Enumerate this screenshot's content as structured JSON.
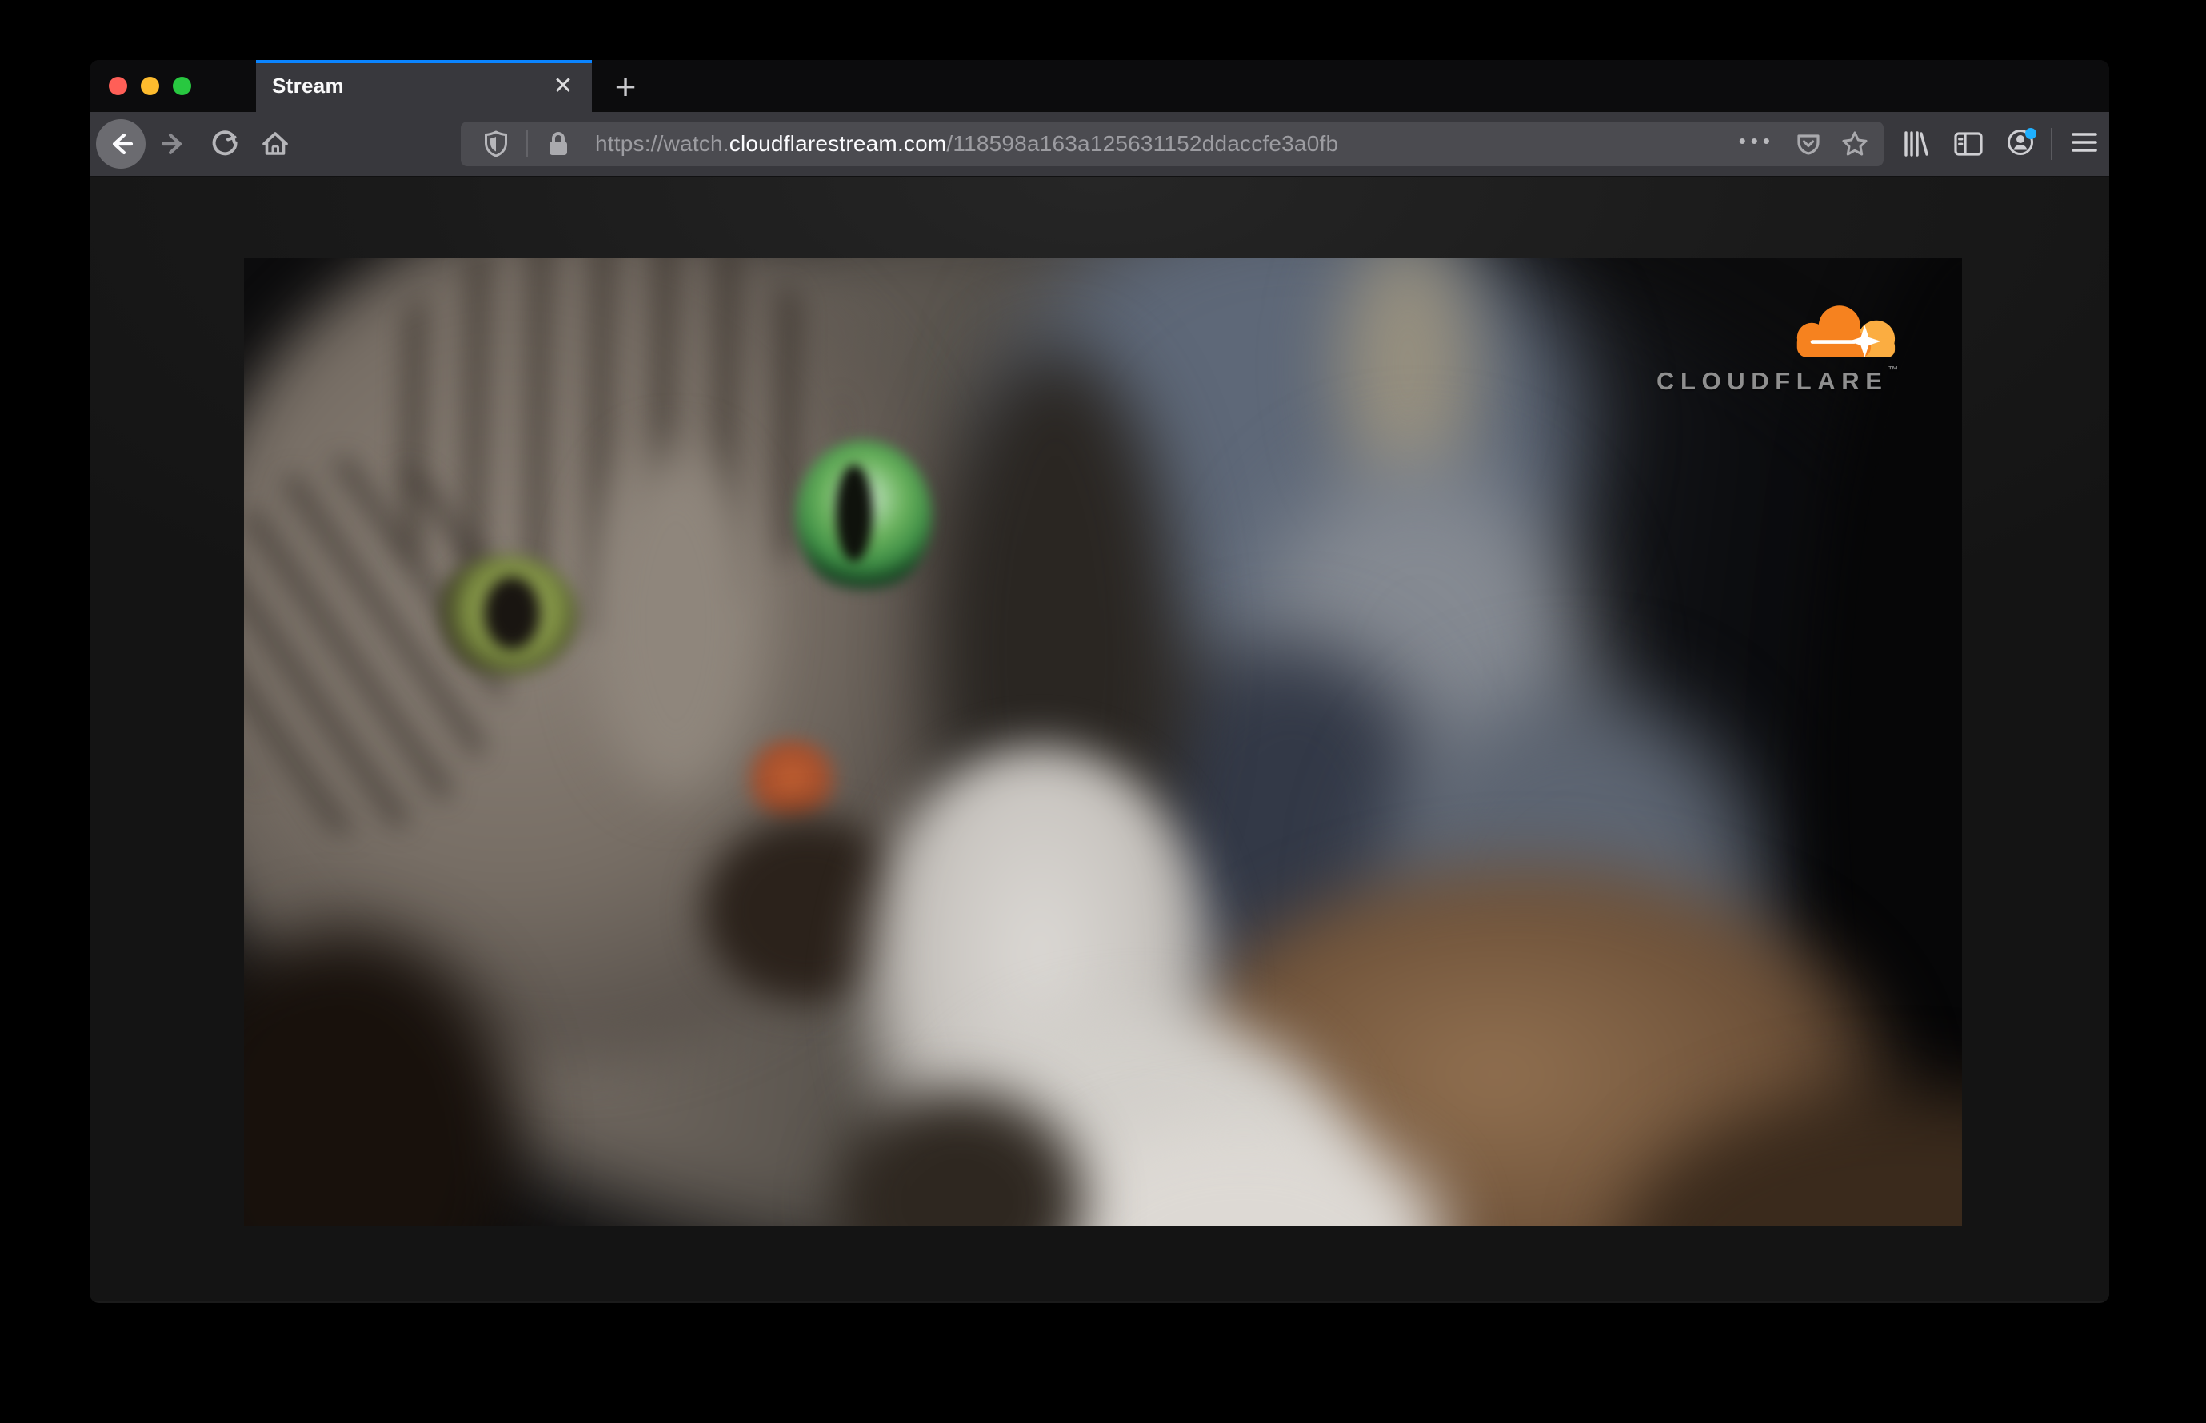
{
  "colors": {
    "accent_blue": "#0a84ff",
    "traffic_red": "#ff5f57",
    "traffic_yellow": "#febc2e",
    "traffic_green": "#28c840",
    "account_badge_blue": "#1fb0ff",
    "cloudflare_orange": "#f6821f",
    "cloudflare_orange_light": "#fbad41"
  },
  "tab_bar": {
    "tab": {
      "title": "Stream",
      "close_icon": "✕"
    },
    "new_tab_icon": "+"
  },
  "toolbar": {
    "icons": {
      "back": "back-arrow",
      "forward": "forward-arrow",
      "reload": "reload-circular-arrow",
      "home": "home-house",
      "library": "library-books",
      "sidebar": "sidebar-panels",
      "account": "account-person-circle",
      "menu": "hamburger-menu"
    },
    "address_bar": {
      "shield_icon": "tracking-protection-shield",
      "lock_icon": "https-padlock",
      "url_prefix": "https://watch.",
      "url_domain": "cloudflarestream.com",
      "url_path": "/118598a163a125631152ddaccfe3a0fb",
      "page_actions_icon": "•••",
      "pocket_icon": "pocket-save",
      "bookmark_icon": "bookmark-star"
    }
  },
  "video": {
    "watermark": {
      "logo_text": "CLOUDFLARE",
      "trademark": "™"
    }
  }
}
